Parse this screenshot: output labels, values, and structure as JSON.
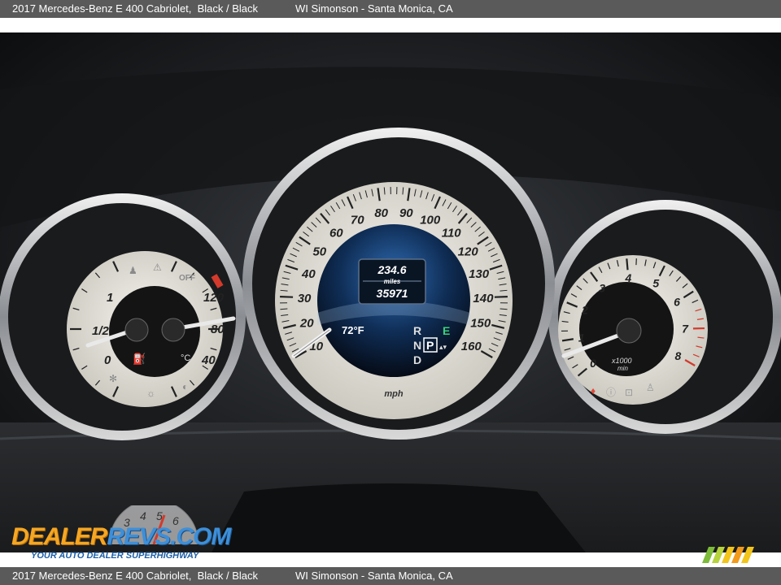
{
  "header": {
    "vehicle": "2017 Mercedes-Benz E 400 Cabriolet,  Black / Black",
    "dealer": "WI Simonson - Santa Monica, CA"
  },
  "footer": {
    "vehicle": "2017 Mercedes-Benz E 400 Cabriolet,  Black / Black",
    "dealer": "WI Simonson - Santa Monica, CA"
  },
  "speedometer": {
    "ticks": [
      "10",
      "20",
      "30",
      "40",
      "50",
      "60",
      "70",
      "80",
      "90",
      "100",
      "110",
      "120",
      "130",
      "140",
      "150",
      "160"
    ],
    "unit": "mph"
  },
  "display": {
    "range_value": "234.6",
    "range_unit": "miles",
    "odometer": "35971",
    "temperature": "72°F",
    "gears": [
      "R",
      "N",
      "D"
    ],
    "selected_gear": "P",
    "eco_indicator": "E"
  },
  "tachometer": {
    "ticks": [
      "0",
      "1",
      "2",
      "3",
      "4",
      "5",
      "6",
      "7",
      "8"
    ],
    "unit_line1": "x1000",
    "unit_line2": "min"
  },
  "left_gauge": {
    "fuel_ticks": [
      "0",
      "1/2",
      "1"
    ],
    "temp_ticks": [
      "40",
      "80",
      "120"
    ],
    "temp_unit": "°C",
    "off_label": "OFF"
  },
  "watermark": {
    "logo_part1": "DEALER",
    "logo_part2": "REVS",
    "logo_part3": ".COM",
    "tagline": "YOUR AUTO DEALER SUPERHIGHWAY"
  },
  "colors": {
    "bar_bg": "#5a5a5a",
    "dial_face": "#e8e6e0",
    "redline": "#d33a2c",
    "display_blue": "#1d4f8a"
  }
}
